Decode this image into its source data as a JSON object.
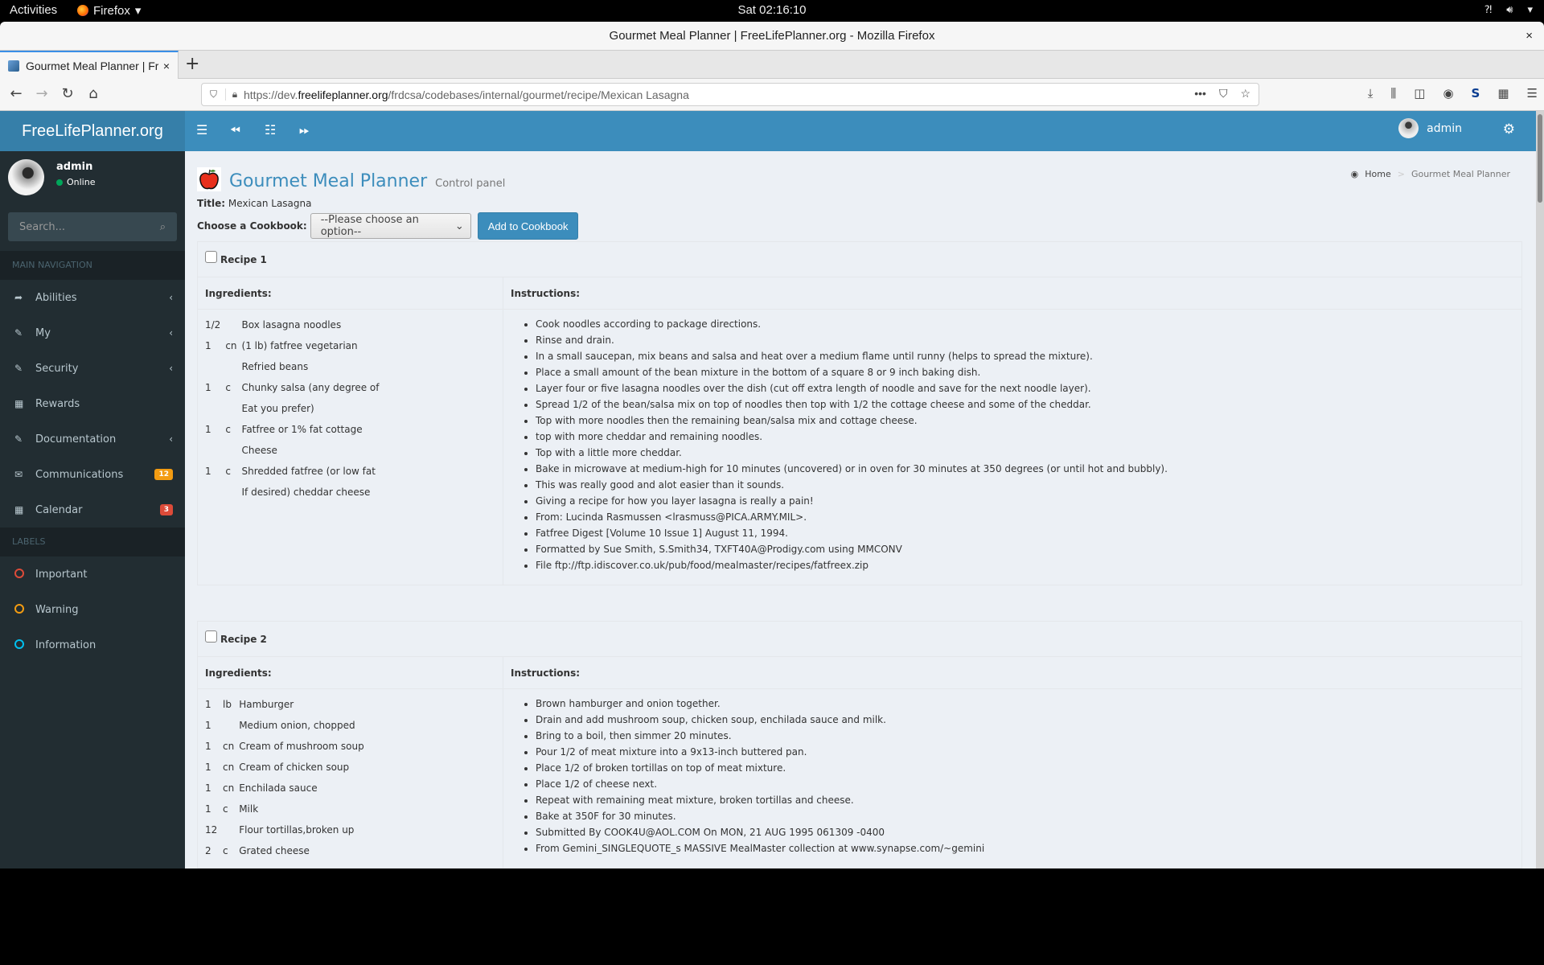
{
  "system_bar": {
    "activities": "Activities",
    "app_menu": "Firefox",
    "clock": "Sat 02:16:10",
    "tray_icons": [
      "network-icon",
      "volume-icon",
      "system-menu-icon"
    ]
  },
  "window": {
    "title": "Gourmet Meal Planner | FreeLifePlanner.org - Mozilla Firefox",
    "close": "×"
  },
  "tabs": [
    {
      "label": "Gourmet Meal Planner | FreeLifePlanner.org",
      "close": "×",
      "active": true
    }
  ],
  "new_tab": "+",
  "navbar": {
    "url_prefix": "https://dev.",
    "url_domain": "freelifeplanner.org",
    "url_path": "/frdcsa/codebases/internal/gourmet/recipe/Mexican Lasagna",
    "toolbar_icons": [
      "downloads-icon",
      "library-icon",
      "sidebar-icon",
      "account-icon",
      "sync-icon",
      "extension-icon",
      "menu-icon"
    ]
  },
  "app": {
    "brand": "FreeLifePlanner.org",
    "top_user": "admin",
    "sidebar": {
      "user": {
        "name": "admin",
        "status": "Online"
      },
      "search_placeholder": "Search...",
      "main_nav_header": "MAIN NAVIGATION",
      "items": [
        {
          "label": "Abilities",
          "icon": "share-icon",
          "chevron": true
        },
        {
          "label": "My",
          "icon": "edit-icon",
          "chevron": true
        },
        {
          "label": "Security",
          "icon": "edit-icon",
          "chevron": true
        },
        {
          "label": "Rewards",
          "icon": "calendar-icon",
          "chevron": false
        },
        {
          "label": "Documentation",
          "icon": "edit-icon",
          "chevron": true
        },
        {
          "label": "Communications",
          "icon": "envelope-icon",
          "badge": "12",
          "badge_color": "#f39c12"
        },
        {
          "label": "Calendar",
          "icon": "calendar-icon",
          "badge": "3",
          "badge_color": "#dd4b39"
        }
      ],
      "labels_header": "LABELS",
      "labels": [
        {
          "label": "Important",
          "color": "#dd4b39"
        },
        {
          "label": "Warning",
          "color": "#f39c12"
        },
        {
          "label": "Information",
          "color": "#00c0ef"
        }
      ]
    },
    "content_header": {
      "title": "Gourmet Meal Planner",
      "subtitle": "Control panel",
      "breadcrumb": [
        "Home",
        "Gourmet Meal Planner"
      ]
    },
    "title_label": "Title:",
    "title_value": "Mexican Lasagna",
    "cookbook_label": "Choose a Cookbook:",
    "cookbook_selected": "--Please choose an option--",
    "add_button": "Add to Cookbook",
    "ingredients_header": "Ingredients:",
    "instructions_header": "Instructions:",
    "recipes": [
      {
        "name": "Recipe 1",
        "checked": false,
        "ingredients": [
          {
            "qty": "1/2",
            "unit": "",
            "item": "Box lasagna noodles"
          },
          {
            "qty": "1",
            "unit": "cn",
            "item": "(1 lb) fatfree vegetarian"
          },
          {
            "qty": "",
            "unit": "",
            "item": "Refried beans"
          },
          {
            "qty": "1",
            "unit": "c",
            "item": "Chunky salsa (any degree of"
          },
          {
            "qty": "",
            "unit": "",
            "item": "Eat you prefer)"
          },
          {
            "qty": "1",
            "unit": "c",
            "item": "Fatfree or 1% fat cottage"
          },
          {
            "qty": "",
            "unit": "",
            "item": "Cheese"
          },
          {
            "qty": "1",
            "unit": "c",
            "item": "Shredded fatfree (or low fat"
          },
          {
            "qty": "",
            "unit": "",
            "item": "If desired) cheddar cheese"
          }
        ],
        "instructions": [
          "Cook noodles according to package directions.",
          "Rinse and drain.",
          "In a small saucepan, mix beans and salsa and heat over a medium flame until runny (helps to spread the mixture).",
          "Place a small amount of the bean mixture in the bottom of a square 8 or 9 inch baking dish.",
          "Layer four or five lasagna noodles over the dish (cut off extra length of noodle and save for the next noodle layer).",
          "Spread 1/2 of the bean/salsa mix on top of noodles then top with 1/2 the cottage cheese and some of the cheddar.",
          "Top with more noodles then the remaining bean/salsa mix and cottage cheese.",
          "top with more cheddar and remaining noodles.",
          "Top with a little more cheddar.",
          "Bake in microwave at medium-high for 10 minutes (uncovered) or in oven for 30 minutes at 350 degrees (or until hot and bubbly).",
          "This was really good and alot easier than it sounds.",
          "Giving a recipe for how you layer lasagna is really a pain!",
          "From: Lucinda Rasmussen <lrasmuss@PICA.ARMY.MIL>.",
          "Fatfree Digest [Volume 10 Issue 1] August 11, 1994.",
          "Formatted by Sue Smith, S.Smith34, TXFT40A@Prodigy.com using MMCONV",
          "File ftp://ftp.idiscover.co.uk/pub/food/mealmaster/recipes/fatfreex.zip"
        ]
      },
      {
        "name": "Recipe 2",
        "checked": false,
        "ingredients": [
          {
            "qty": "1",
            "unit": "lb",
            "item": "Hamburger"
          },
          {
            "qty": "1",
            "unit": "",
            "item": "Medium onion, chopped"
          },
          {
            "qty": "1",
            "unit": "cn",
            "item": "Cream of mushroom soup"
          },
          {
            "qty": "1",
            "unit": "cn",
            "item": "Cream of chicken soup"
          },
          {
            "qty": "1",
            "unit": "cn",
            "item": "Enchilada sauce"
          },
          {
            "qty": "1",
            "unit": "c",
            "item": "Milk"
          },
          {
            "qty": "12",
            "unit": "",
            "item": "Flour tortillas,broken up"
          },
          {
            "qty": "2",
            "unit": "c",
            "item": "Grated cheese"
          }
        ],
        "instructions": [
          "Brown hamburger and onion together.",
          "Drain and add mushroom soup, chicken soup, enchilada sauce and milk.",
          "Bring to a boil, then simmer 20 minutes.",
          "Pour 1/2 of meat mixture into a 9x13-inch buttered pan.",
          "Place 1/2 of broken tortillas on top of meat mixture.",
          "Place 1/2 of cheese next.",
          "Repeat with remaining meat mixture, broken tortillas and cheese.",
          "Bake at 350F for 30 minutes.",
          "Submitted By COOK4U@AOL.COM On MON, 21 AUG 1995 061309 -0400",
          "From Gemini_SINGLEQUOTE_s MASSIVE MealMaster collection at www.synapse.com/~gemini"
        ]
      }
    ]
  },
  "colors": {
    "header_blue": "#3c8dbc",
    "logo_blue": "#367fa9",
    "sidebar_bg": "#222d32",
    "content_bg": "#ecf0f5"
  }
}
